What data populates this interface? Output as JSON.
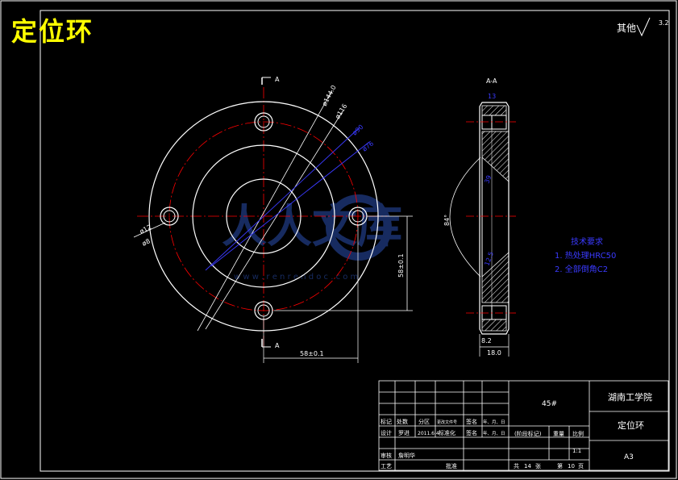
{
  "part_title": "定位环",
  "roughness": {
    "label": "其他",
    "value": "3.2"
  },
  "section_labels": {
    "left_a": "A",
    "bottom_a": "A",
    "section_view": "A-A"
  },
  "dims": {
    "phi_144": "ø144.0",
    "phi_116": "ø116",
    "phi_90": "ø90",
    "phi_76": "ø76",
    "phi_12": "ø12",
    "phi_8": "ø8",
    "d_581": "58±0.1",
    "d_581_v": "58±0.1",
    "angle_84": "84°",
    "d_13": "13",
    "d_39": "39",
    "d_12_5": "12.5",
    "d_8_2": "8.2",
    "d_18": "18.0"
  },
  "tech_requirements": {
    "title": "技术要求",
    "items": [
      "1. 热处理HRC50",
      "2. 全部倒角C2"
    ]
  },
  "watermark": {
    "text": "人人文库",
    "url": "w w w . r e n r e n d o c . c o m"
  },
  "title_block": {
    "material": "45#",
    "school": "湖南工学院",
    "part_name": "定位环",
    "size": "A3",
    "scale_label": "比例",
    "scale_value": "1:1",
    "weight_label": "重量",
    "stage_label": "(阶段标记)",
    "sheets_total_label": "共",
    "sheets_total": "14",
    "sheet_label": "张",
    "sheet_no_label": "第",
    "sheet_no": "10",
    "sheet_no_unit": "页",
    "row_labels": {
      "mark": "标记",
      "count": "处数",
      "zone": "分区",
      "change_doc": "更改文件号",
      "sign": "签名",
      "date": "年、月、日",
      "design": "设计",
      "designer": "罗进",
      "design_date": "2011.6.4",
      "standard": "标准化",
      "review": "审核",
      "reviewer": "詹明华",
      "process": "工艺",
      "approve": "批准"
    }
  }
}
